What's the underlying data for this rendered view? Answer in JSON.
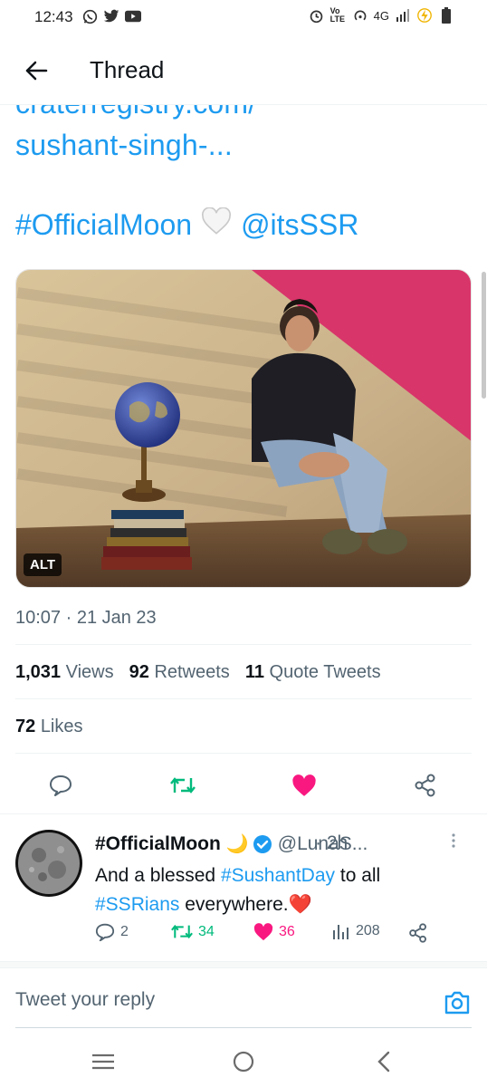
{
  "status_bar": {
    "time": "12:43",
    "network": "4G",
    "volte": "Vo LTE"
  },
  "header": {
    "title": "Thread"
  },
  "tweet": {
    "link_line1": "craterregistry.com/",
    "link_line2": "sushant-singh-...",
    "hashtag": "#OfficialMoon",
    "mention": "@itsSSR",
    "alt_label": "ALT",
    "timestamp": "10:07 · 21 Jan 23",
    "views_count": "1,031",
    "views_label": "Views",
    "retweets_count": "92",
    "retweets_label": "Retweets",
    "quotes_count": "11",
    "quotes_label": "Quote Tweets",
    "likes_count": "72",
    "likes_label": "Likes"
  },
  "reply": {
    "name": "#OfficialMoon",
    "moon_emoji": "🌙",
    "handle": "@LunaS...",
    "time": "· 2h",
    "text_1": "And a blessed ",
    "hashtag_1": "#SushantDay",
    "text_2": " to all",
    "hashtag_2": "#SSRians",
    "text_3": " everywhere.",
    "heart_emoji": "❤️",
    "replies": "2",
    "retweets": "34",
    "likes": "36",
    "views": "208"
  },
  "compose": {
    "placeholder": "Tweet your reply"
  },
  "colors": {
    "accent": "#1d9bf0",
    "retweet_green": "#00ba7c",
    "like_pink": "#f91880",
    "secondary_text": "#536471"
  }
}
